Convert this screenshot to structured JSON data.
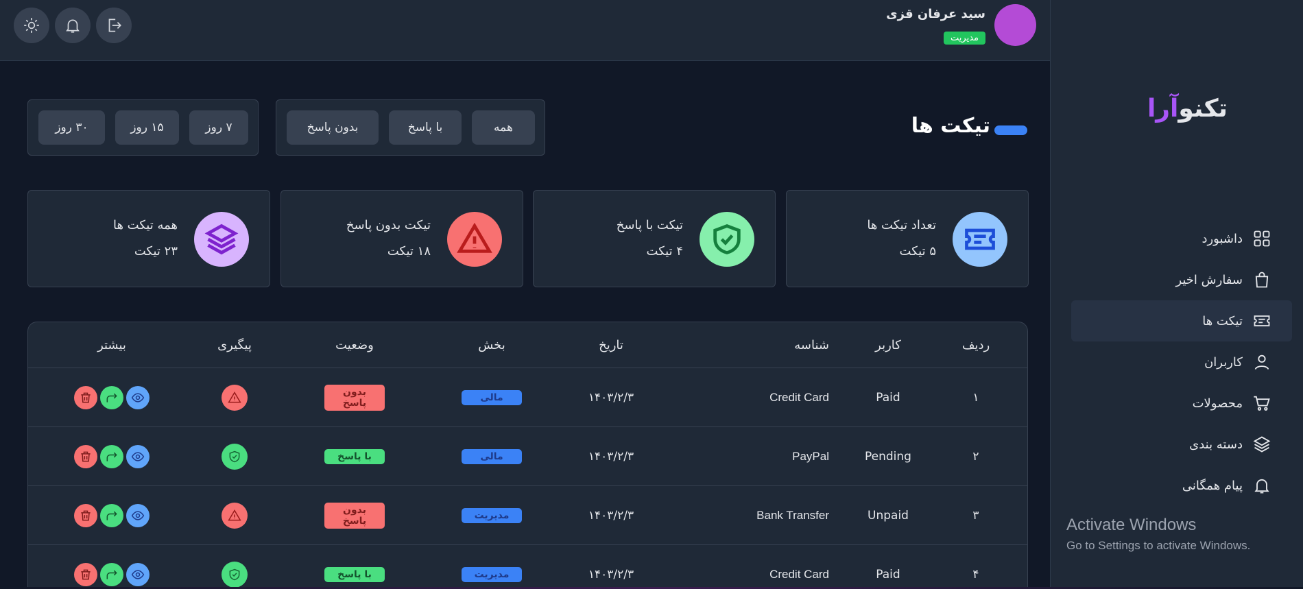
{
  "brand": {
    "logo_main": "تکنو",
    "logo_accent": "آرا"
  },
  "header": {
    "user_name": "سید عرفان قزی",
    "user_role": "مدیریت"
  },
  "sidebar": {
    "items": [
      {
        "label": "داشبورد",
        "icon": "grid-icon"
      },
      {
        "label": "سفارش اخیر",
        "icon": "bag-icon"
      },
      {
        "label": "تیکت ها",
        "icon": "ticket-icon"
      },
      {
        "label": "کاربران",
        "icon": "user-icon"
      },
      {
        "label": "محصولات",
        "icon": "cart-icon"
      },
      {
        "label": "دسته بندی",
        "icon": "layers-icon"
      },
      {
        "label": "پیام همگانی",
        "icon": "bell-icon"
      }
    ],
    "active_index": 2
  },
  "watermark": {
    "line1": "Activate Windows",
    "line2": "Go to Settings to activate Windows."
  },
  "page": {
    "title": "تیکت ها"
  },
  "filters": {
    "status": [
      "همه",
      "با پاسخ",
      "بدون پاسخ"
    ],
    "period": [
      "۷ روز",
      "۱۵ روز",
      "۳۰ روز"
    ]
  },
  "stats": [
    {
      "title": "تعداد تیکت ها",
      "value": "۵ تیکت",
      "icon": "ticket-icon",
      "color": "#93c5fd",
      "stroke": "#1d4ed8"
    },
    {
      "title": "تیکت با پاسخ",
      "value": "۴ تیکت",
      "icon": "shield-check-icon",
      "color": "#86efac",
      "stroke": "#15803d"
    },
    {
      "title": "تیکت بدون پاسخ",
      "value": "۱۸ تیکت",
      "icon": "warning-icon",
      "color": "#f87171",
      "stroke": "#b91c1c"
    },
    {
      "title": "همه تیکت ها",
      "value": "۲۳ تیکت",
      "icon": "layers-icon",
      "color": "#d8b4fe",
      "stroke": "#7e22ce"
    }
  ],
  "table": {
    "headers": [
      "ردیف",
      "کاربر",
      "شناسه",
      "تاریخ",
      "بخش",
      "وضعیت",
      "پیگیری",
      "بیشتر"
    ],
    "rows": [
      {
        "index": "۱",
        "user": "Paid",
        "id": "Credit Card",
        "date": "۱۴۰۳/۲/۳",
        "section": "مالی",
        "status": "بدون پاسخ",
        "followup": "warning"
      },
      {
        "index": "۲",
        "user": "Pending",
        "id": "PayPal",
        "date": "۱۴۰۳/۲/۳",
        "section": "مالی",
        "status": "با پاسخ",
        "followup": "ok"
      },
      {
        "index": "۳",
        "user": "Unpaid",
        "id": "Bank Transfer",
        "date": "۱۴۰۳/۲/۳",
        "section": "مدیریت",
        "status": "بدون پاسخ",
        "followup": "warning"
      },
      {
        "index": "۴",
        "user": "Paid",
        "id": "Credit Card",
        "date": "۱۴۰۳/۲/۳",
        "section": "مدیریت",
        "status": "با پاسخ",
        "followup": "ok"
      }
    ]
  },
  "colors": {
    "accent": "#3b82f6",
    "success": "#22c55e",
    "danger": "#f87171",
    "purple": "#a855f7"
  }
}
